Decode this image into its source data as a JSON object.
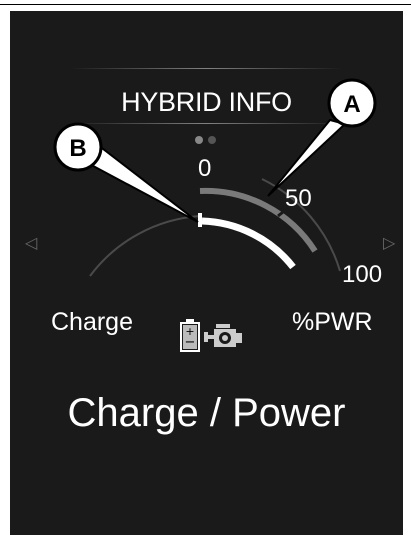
{
  "header": {
    "title": "HYBRID INFO"
  },
  "scale": {
    "zero": "0",
    "mid": "50",
    "max": "100"
  },
  "labels": {
    "left": "Charge",
    "right": "%PWR",
    "main": "Charge / Power"
  },
  "callouts": {
    "a": "A",
    "b": "B"
  },
  "icons": {
    "battery": "battery-icon",
    "engine": "engine-icon",
    "prev": "left-arrow-icon",
    "next": "right-arrow-icon"
  },
  "colors": {
    "screen": "#1a1a1a",
    "text": "#ffffff",
    "gray_bar": "#7a7a7a"
  }
}
